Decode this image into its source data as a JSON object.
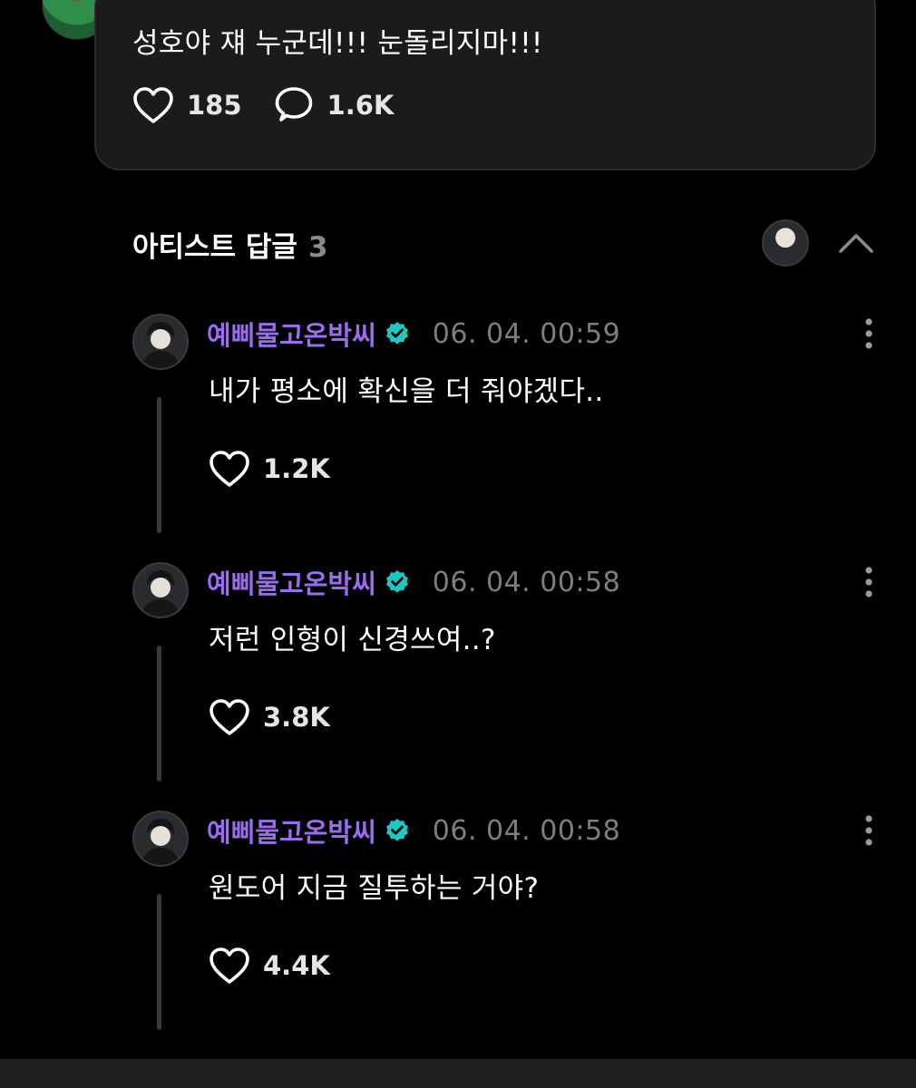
{
  "post": {
    "text": "성호야 쟤 누군데!!! 눈돌리지마!!!",
    "likes": "185",
    "comments": "1.6K"
  },
  "artist_replies": {
    "title": "아티스트 답글",
    "count": "3"
  },
  "replies": [
    {
      "author": "예삐물고온박씨",
      "time": "06. 04. 00:59",
      "text": "내가 평소에 확신을 더 줘야겠다..",
      "likes": "1.2K"
    },
    {
      "author": "예삐물고온박씨",
      "time": "06. 04. 00:58",
      "text": "저런 인형이 신경쓰여..?",
      "likes": "3.8K"
    },
    {
      "author": "예삐물고온박씨",
      "time": "06. 04. 00:58",
      "text": "원도어 지금 질투하는 거야?",
      "likes": "4.4K"
    }
  ],
  "colors": {
    "background": "#000000",
    "card": "#1b1b1d",
    "author_name": "#9b6cf0",
    "verified_badge": "#1fc7c2",
    "timestamp": "#7d7d82",
    "thread_line": "#3a3a3c"
  },
  "icons": {
    "like": "heart-outline-icon",
    "comment": "speech-bubble-icon",
    "verified": "verified-badge-icon",
    "more": "vertical-ellipsis-icon",
    "collapse": "chevron-up-icon"
  }
}
